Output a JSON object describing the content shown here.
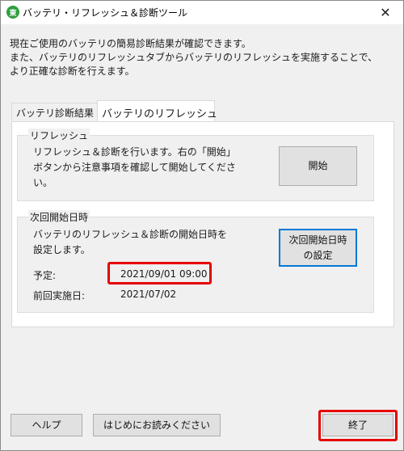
{
  "window": {
    "title": "バッテリ・リフレッシュ＆診断ツール",
    "close_glyph": "✕",
    "icon_glyph": "東"
  },
  "intro": {
    "lines": [
      "現在ご使用のバッテリの簡易診断結果が確認できます。",
      "また、バッテリのリフレッシュタブからバッテリのリフレッシュを実施することで、",
      "より正確な診断を行えます。"
    ]
  },
  "tabs": [
    {
      "label": "バッテリ診断結果",
      "active": false
    },
    {
      "label": "バッテリのリフレッシュ",
      "active": true
    }
  ],
  "refresh_group": {
    "title": "リフレッシュ",
    "description_lines": [
      "リフレッシュ＆診断を行います。右の「開始」",
      "ボタンから注意事項を確認して開始してくださ",
      "い。"
    ],
    "start_button": "開始"
  },
  "schedule_group": {
    "title": "次回開始日時",
    "description_lines": [
      "バッテリのリフレッシュ＆診断の開始日時を",
      "設定します。"
    ],
    "set_button_lines": [
      "次回開始日時",
      "の設定"
    ],
    "scheduled_label": "予定:",
    "scheduled_value": "2021/09/01 09:00",
    "last_run_label": "前回実施日:",
    "last_run_value": "2021/07/02"
  },
  "footer": {
    "help_button": "ヘルプ",
    "readme_button": "はじめにお読みください",
    "exit_button": "終了"
  },
  "colors": {
    "highlight": "#e60000",
    "focus": "#0078d7"
  }
}
